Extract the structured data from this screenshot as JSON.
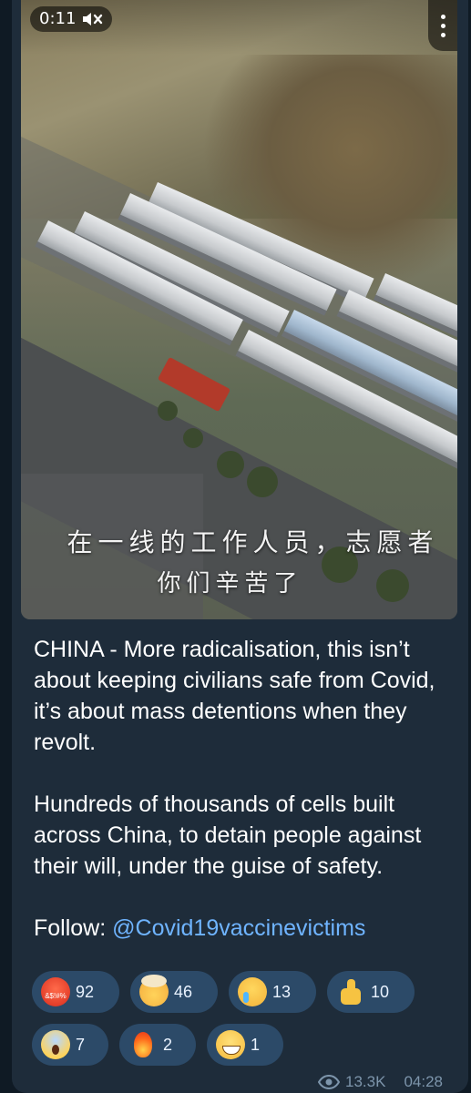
{
  "video": {
    "duration": "0:11",
    "muted": true,
    "subtitle_line1": "在一线的工作人员，志愿者",
    "subtitle_line2": "你们辛苦了"
  },
  "message": {
    "paragraph1": "CHINA - More radicalisation, this isn’t about keeping civilians safe from Covid, it’s about mass detentions when they revolt.",
    "paragraph2": "Hundreds of thousands of cells built across China, to detain people against their will, under the guise of safety.",
    "follow_label": "Follow:",
    "follow_handle": "@Covid19vaccinevictims"
  },
  "reactions": [
    {
      "emoji": "angry-cursing-face",
      "count": "92"
    },
    {
      "emoji": "exploding-head",
      "count": "46"
    },
    {
      "emoji": "crying-face",
      "count": "13"
    },
    {
      "emoji": "thumbs-up",
      "count": "10"
    },
    {
      "emoji": "screaming-face",
      "count": "7"
    },
    {
      "emoji": "fire",
      "count": "2"
    },
    {
      "emoji": "grinning-face",
      "count": "1"
    }
  ],
  "footer": {
    "views": "13.3K",
    "time": "04:28"
  },
  "colors": {
    "bubble": "#1e2c3a",
    "link": "#6fb4ff",
    "reaction_bg": "#2c4a68",
    "meta": "#7d95ab"
  }
}
